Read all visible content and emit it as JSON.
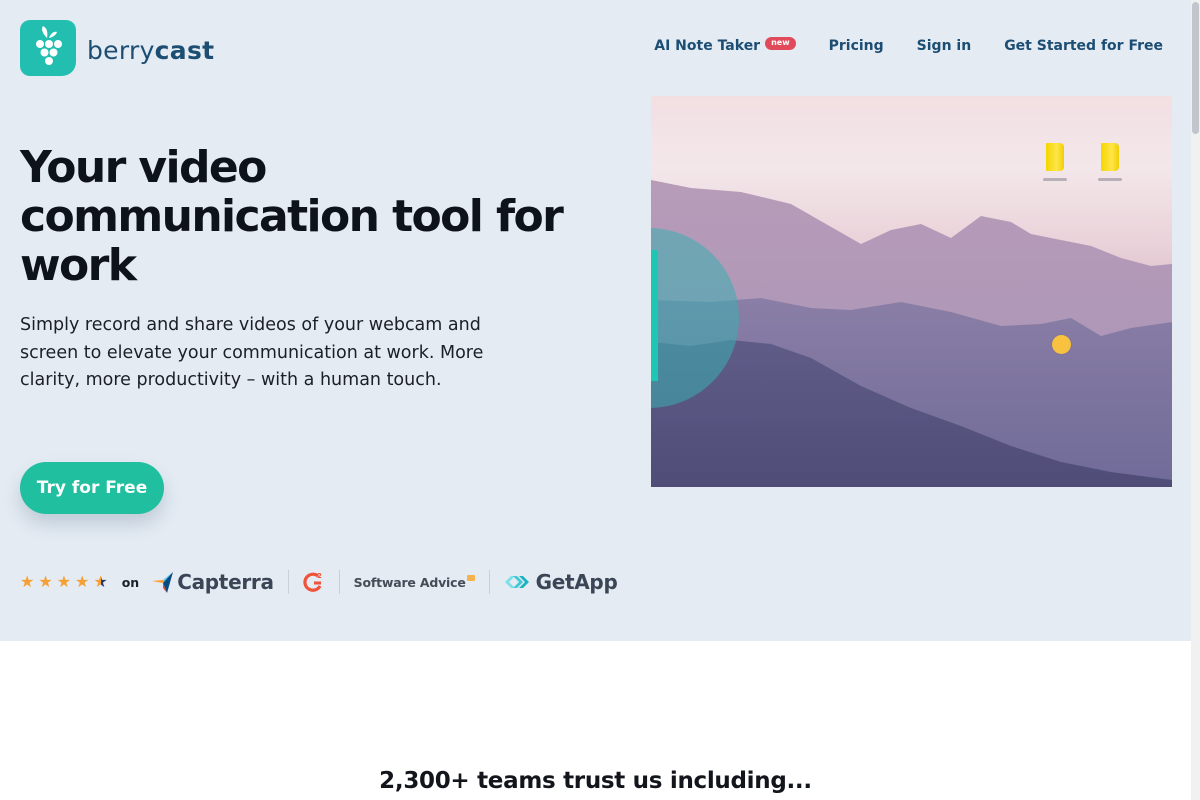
{
  "header": {
    "logo": {
      "text_light": "berry",
      "text_bold": "cast",
      "icon": "grape-icon"
    },
    "nav": [
      {
        "label": "AI Note Taker",
        "badge": "new"
      },
      {
        "label": "Pricing"
      },
      {
        "label": "Sign in"
      },
      {
        "label": "Get Started for Free"
      }
    ]
  },
  "hero": {
    "headline": "Your video communication tool for work",
    "subtext": "Simply record and share videos of your webcam and screen to elevate your communication at work. More clarity, more productivity – with a human touch.",
    "cta_label": "Try for Free",
    "rating": {
      "stars": 4.5,
      "on_label": "on",
      "platforms": [
        "Capterra",
        "G2",
        "Software Advice",
        "GetApp"
      ]
    },
    "preview": {
      "description": "Screen recording preview with mountain desktop wallpaper, webcam bubble and cursor highlight",
      "desktop_folders": 2
    }
  },
  "colors": {
    "brand_teal": "#22bfb0",
    "cta_green": "#1fbf9f",
    "nav_text": "#1c4d73",
    "badge_red": "#e14a5b",
    "hero_bg": "#e4ebf3",
    "star_orange": "#f5a033"
  },
  "trust": {
    "heading": "2,300+ teams trust us including..."
  }
}
